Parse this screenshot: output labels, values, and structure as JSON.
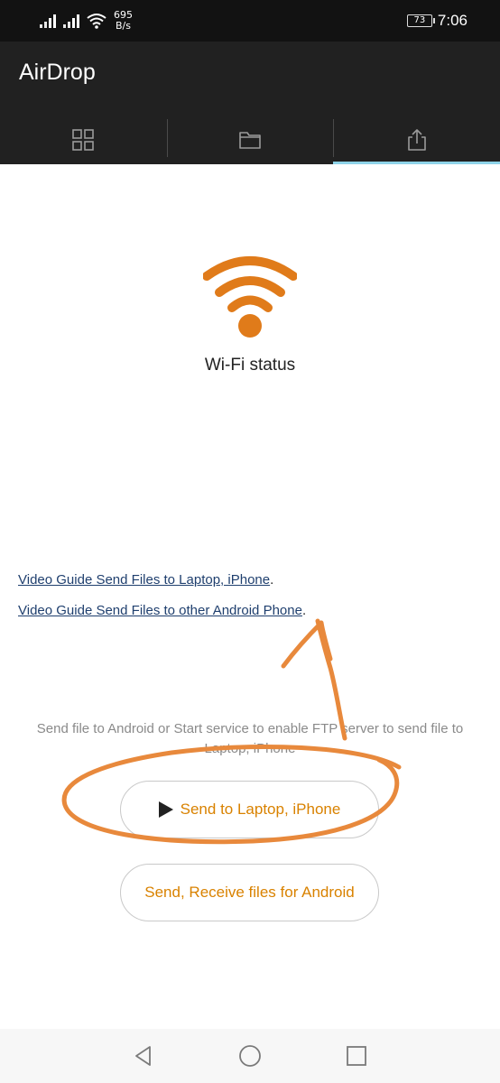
{
  "status_bar": {
    "net_speed_value": "695",
    "net_speed_unit": "B/s",
    "battery": "73",
    "time": "7:06"
  },
  "app": {
    "title": "AirDrop"
  },
  "tabs": [
    {
      "icon": "grid-icon",
      "active": false
    },
    {
      "icon": "folder-icon",
      "active": false
    },
    {
      "icon": "share-icon",
      "active": true
    }
  ],
  "wifi": {
    "icon": "wifi-icon",
    "label": "Wi-Fi status"
  },
  "links": {
    "laptop_guide": "Video Guide Send Files to Laptop, iPhone",
    "android_guide": "Video Guide Send Files to other Android Phone",
    "punct": "."
  },
  "info_text": "Send file to Android or Start service to enable FTP server to send file to Laptop, iPhone",
  "buttons": {
    "send_laptop": "Send to Laptop, iPhone",
    "send_android": "Send, Receive files for Android"
  },
  "colors": {
    "accent_orange": "#e07b1a",
    "button_text": "#d98200",
    "link_blue": "#1f3f6e",
    "annotation_orange": "#e8893c",
    "active_tab": "#8fd3e8"
  },
  "nav": {
    "back": "back-icon",
    "home": "home-icon",
    "recents": "recents-icon"
  }
}
